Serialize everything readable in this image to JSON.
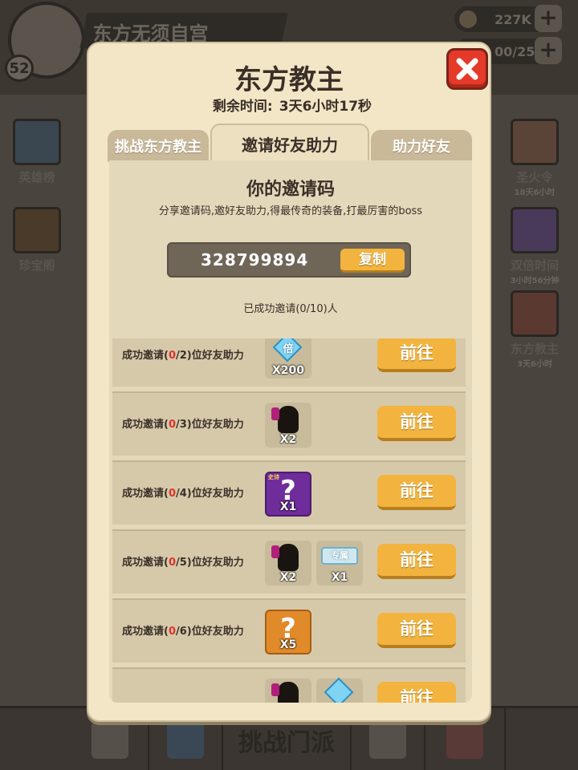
{
  "background": {
    "guild_name": "东方无须自宫",
    "level": "52",
    "resources": [
      {
        "value": "227K",
        "icon": "coin-icon"
      },
      {
        "value": "00/25",
        "icon": "stamina-icon"
      }
    ],
    "left_side": [
      {
        "label": "英雄榜",
        "icon": "ranking-icon"
      },
      {
        "label": "珍宝阁",
        "icon": "treasure-chest-icon"
      }
    ],
    "right_side": [
      {
        "label": "圣火令",
        "sub": "18天6小时",
        "icon": "holy-fire-token-icon"
      },
      {
        "label": "双倍时间",
        "sub": "3小时56分钟",
        "icon": "double-time-icon"
      },
      {
        "label": "东方教主",
        "sub": "3天6小时",
        "icon": "boss-palace-icon"
      }
    ],
    "bottom_bar": {
      "center_label": "挑战门派"
    }
  },
  "dialog": {
    "title": "东方教主",
    "timer_label": "剩余时间:",
    "timer_value": "3天6小时17秒",
    "tabs": [
      {
        "label": "挑战东方教主",
        "active": false
      },
      {
        "label": "邀请好友助力",
        "active": true
      },
      {
        "label": "助力好友",
        "active": false
      }
    ],
    "invite": {
      "title": "你的邀请码",
      "description": "分享邀请码,邀好友助力,得最传奇的装备,打最厉害的boss",
      "code": "328799894",
      "copy_label": "复制",
      "invited_status": "已成功邀请(0/10)人"
    },
    "rewards": [
      {
        "prefix": "成功邀请(",
        "done": "0",
        "rest": "/2)位好友助力",
        "go_label": "前往",
        "items": [
          {
            "type": "diamond",
            "text": "倍",
            "qty": "X200"
          }
        ]
      },
      {
        "prefix": "成功邀请(",
        "done": "0",
        "rest": "/3)位好友助力",
        "go_label": "前往",
        "items": [
          {
            "type": "figure",
            "qty": "X2"
          }
        ]
      },
      {
        "prefix": "成功邀请(",
        "done": "0",
        "rest": "/4)位好友助力",
        "go_label": "前往",
        "items": [
          {
            "type": "purple",
            "text": "?",
            "tag": "史诗",
            "qty": "X1"
          }
        ]
      },
      {
        "prefix": "成功邀请(",
        "done": "0",
        "rest": "/5)位好友助力",
        "go_label": "前往",
        "items": [
          {
            "type": "figure",
            "qty": "X2"
          },
          {
            "type": "badge",
            "text": "专属",
            "qty": "X1"
          }
        ]
      },
      {
        "prefix": "成功邀请(",
        "done": "0",
        "rest": "/6)位好友助力",
        "go_label": "前往",
        "items": [
          {
            "type": "orange",
            "text": "?",
            "qty": "X5"
          }
        ]
      },
      {
        "prefix": "",
        "done": "",
        "rest": "",
        "go_label": "前往",
        "items": [
          {
            "type": "figure",
            "qty": ""
          },
          {
            "type": "diamond",
            "text": "",
            "qty": ""
          }
        ]
      }
    ]
  },
  "colors": {
    "accent": "#f2b43e",
    "close": "#e53a2a",
    "highlight_red": "#e0342a",
    "panel": "#f3e6c6"
  }
}
